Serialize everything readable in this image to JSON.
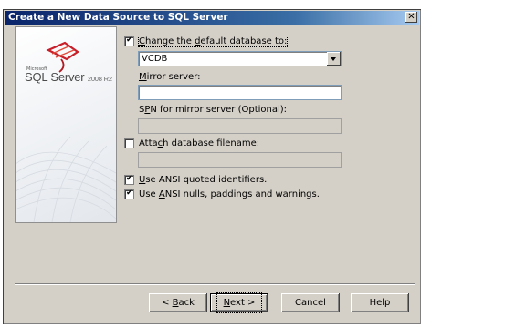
{
  "window": {
    "title": "Create a New Data Source to SQL Server",
    "close_glyph": "✕"
  },
  "banner": {
    "vendor": "Microsoft",
    "product": "SQL Server",
    "version": "2008 R2",
    "icon": "sql-server-logo-icon"
  },
  "options": {
    "change_default_db": {
      "label": "Change the default database to:",
      "checked": true,
      "value": "VCDB"
    },
    "mirror_server": {
      "label": "Mirror server:",
      "value": ""
    },
    "spn_mirror": {
      "label": "SPN for mirror server (Optional):",
      "value": "",
      "disabled": true
    },
    "attach_db": {
      "label": "Attach database filename:",
      "checked": false,
      "value": "",
      "disabled": true
    },
    "ansi_quoted": {
      "label": "Use ANSI quoted identifiers.",
      "checked": true
    },
    "ansi_nulls": {
      "label": "Use ANSI nulls, paddings and warnings.",
      "checked": true
    }
  },
  "buttons": {
    "back": "< Back",
    "next": "Next >",
    "cancel": "Cancel",
    "help": "Help"
  },
  "colors": {
    "title_start": "#0a246a",
    "title_end": "#a6caf0",
    "face": "#d4d0c8",
    "logo_red": "#c8202a"
  }
}
